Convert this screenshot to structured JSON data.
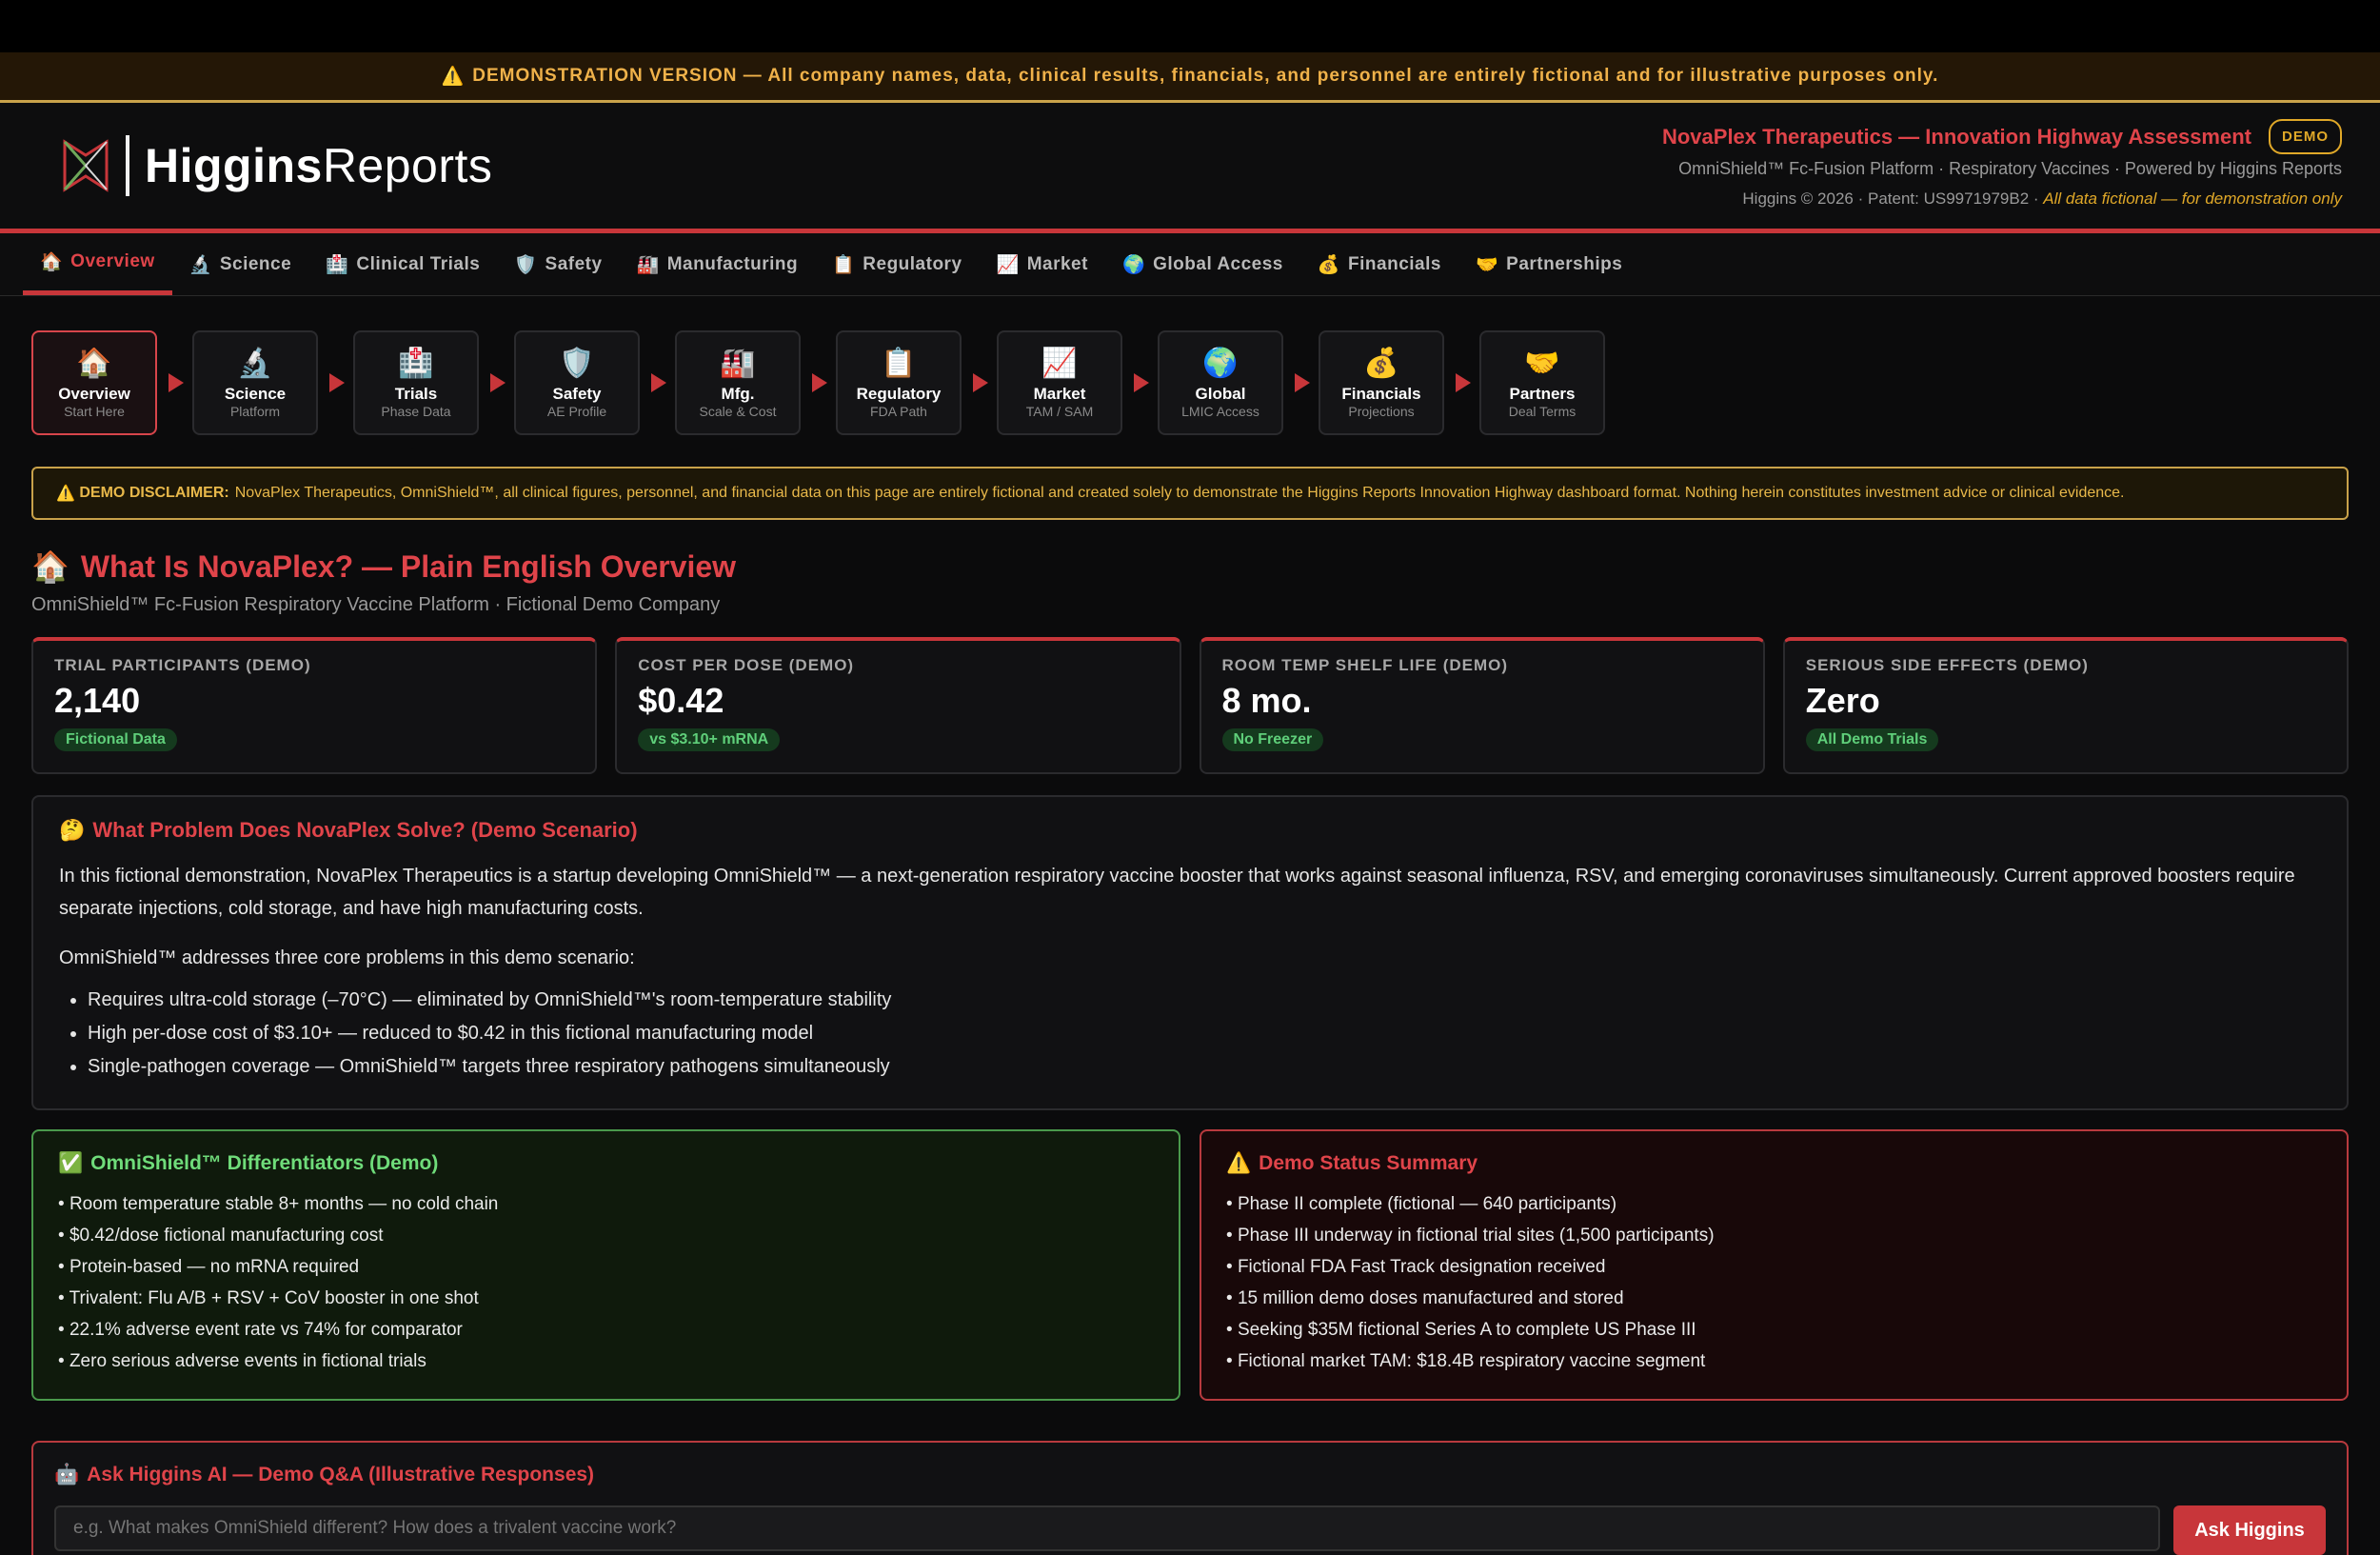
{
  "banner": {
    "icon": "⚠️",
    "text": "DEMONSTRATION VERSION — All company names, data, clinical results, financials, and personnel are entirely fictional and for illustrative purposes only."
  },
  "header": {
    "brand_bold": "Higgins",
    "brand_light": "Reports",
    "title": "NovaPlex Therapeutics — Innovation Highway Assessment",
    "demo_pill": "DEMO",
    "subtitle": "OmniShield™ Fc-Fusion Platform · Respiratory Vaccines · Powered by Higgins Reports",
    "copyright": "Higgins © 2026 · Patent: US9971979B2 · ",
    "copyright_note": "All data fictional — for demonstration only"
  },
  "tabs": [
    {
      "icon": "🏠",
      "label": "Overview"
    },
    {
      "icon": "🔬",
      "label": "Science"
    },
    {
      "icon": "🏥",
      "label": "Clinical Trials"
    },
    {
      "icon": "🛡️",
      "label": "Safety"
    },
    {
      "icon": "🏭",
      "label": "Manufacturing"
    },
    {
      "icon": "📋",
      "label": "Regulatory"
    },
    {
      "icon": "📈",
      "label": "Market"
    },
    {
      "icon": "🌍",
      "label": "Global Access"
    },
    {
      "icon": "💰",
      "label": "Financials"
    },
    {
      "icon": "🤝",
      "label": "Partnerships"
    }
  ],
  "steps": [
    {
      "icon": "🏠",
      "title": "Overview",
      "sub": "Start Here"
    },
    {
      "icon": "🔬",
      "title": "Science",
      "sub": "Platform"
    },
    {
      "icon": "🏥",
      "title": "Trials",
      "sub": "Phase Data"
    },
    {
      "icon": "🛡️",
      "title": "Safety",
      "sub": "AE Profile"
    },
    {
      "icon": "🏭",
      "title": "Mfg.",
      "sub": "Scale & Cost"
    },
    {
      "icon": "📋",
      "title": "Regulatory",
      "sub": "FDA Path"
    },
    {
      "icon": "📈",
      "title": "Market",
      "sub": "TAM / SAM"
    },
    {
      "icon": "🌍",
      "title": "Global",
      "sub": "LMIC Access"
    },
    {
      "icon": "💰",
      "title": "Financials",
      "sub": "Projections"
    },
    {
      "icon": "🤝",
      "title": "Partners",
      "sub": "Deal Terms"
    }
  ],
  "disclaimer": {
    "icon": "⚠️",
    "label": "DEMO DISCLAIMER:",
    "text": "NovaPlex Therapeutics, OmniShield™, all clinical figures, personnel, and financial data on this page are entirely fictional and created solely to demonstrate the Higgins Reports Innovation Highway dashboard format. Nothing herein constitutes investment advice or clinical evidence."
  },
  "overview": {
    "icon": "🏠",
    "title": "What Is NovaPlex? — Plain English Overview",
    "subtitle": "OmniShield™ Fc-Fusion Respiratory Vaccine Platform · Fictional Demo Company"
  },
  "kpis": [
    {
      "label": "TRIAL PARTICIPANTS (DEMO)",
      "value": "2,140",
      "badge": "Fictional Data"
    },
    {
      "label": "COST PER DOSE (DEMO)",
      "value": "$0.42",
      "badge": "vs $3.10+ mRNA"
    },
    {
      "label": "ROOM TEMP SHELF LIFE (DEMO)",
      "value": "8 mo.",
      "badge": "No Freezer"
    },
    {
      "label": "SERIOUS SIDE EFFECTS (DEMO)",
      "value": "Zero",
      "badge": "All Demo Trials"
    }
  ],
  "problem": {
    "icon": "🤔",
    "title": "What Problem Does NovaPlex Solve? (Demo Scenario)",
    "para1": "In this fictional demonstration, NovaPlex Therapeutics is a startup developing OmniShield™ — a next-generation respiratory vaccine booster that works against seasonal influenza, RSV, and emerging coronaviruses simultaneously. Current approved boosters require separate injections, cold storage, and have high manufacturing costs.",
    "para2": "OmniShield™ addresses three core problems in this demo scenario:",
    "bullets": [
      "Requires ultra-cold storage (–70°C) — eliminated by OmniShield™'s room-temperature stability",
      "High per-dose cost of $3.10+ — reduced to $0.42 in this fictional manufacturing model",
      "Single-pathogen coverage — OmniShield™ targets three respiratory pathogens simultaneously"
    ]
  },
  "differentiators": {
    "icon": "✅",
    "title": "OmniShield™ Differentiators (Demo)",
    "items": [
      "Room temperature stable 8+ months — no cold chain",
      "$0.42/dose fictional manufacturing cost",
      "Protein-based — no mRNA required",
      "Trivalent: Flu A/B + RSV + CoV booster in one shot",
      "22.1% adverse event rate vs 74% for comparator",
      "Zero serious adverse events in fictional trials"
    ]
  },
  "status": {
    "icon": "⚠️",
    "title": "Demo Status Summary",
    "items": [
      "Phase II complete (fictional — 640 participants)",
      "Phase III underway in fictional trial sites (1,500 participants)",
      "Fictional FDA Fast Track designation received",
      "15 million demo doses manufactured and stored",
      "Seeking $35M fictional Series A to complete US Phase III",
      "Fictional market TAM: $18.4B respiratory vaccine segment"
    ]
  },
  "ask": {
    "icon": "🤖",
    "title": "Ask Higgins AI — Demo Q&A (Illustrative Responses)",
    "placeholder": "e.g. What makes OmniShield different? How does a trivalent vaccine work?",
    "button": "Ask Higgins"
  },
  "colors": {
    "accent": "#c8363a",
    "warning": "#e0a828",
    "success": "#5fcf7a"
  }
}
